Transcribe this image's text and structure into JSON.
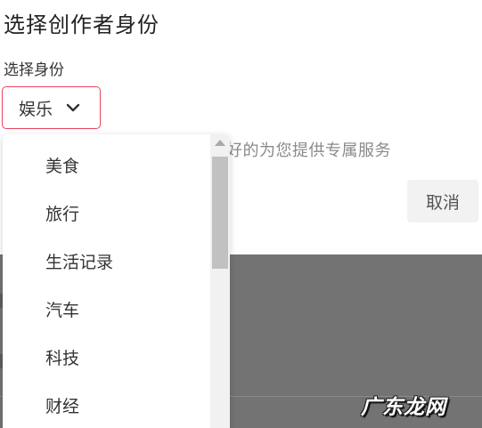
{
  "dialog": {
    "title": "选择创作者身份",
    "field_label": "选择身份",
    "selected_value": "娱乐",
    "hint": "好的为您提供专属服务",
    "cancel_label": "取消"
  },
  "dropdown": {
    "options": [
      "美食",
      "旅行",
      "生活记录",
      "汽车",
      "科技",
      "财经"
    ]
  },
  "watermark": "广东龙网",
  "colors": {
    "accent_border": "#e8465e",
    "overlay": "#737373"
  }
}
